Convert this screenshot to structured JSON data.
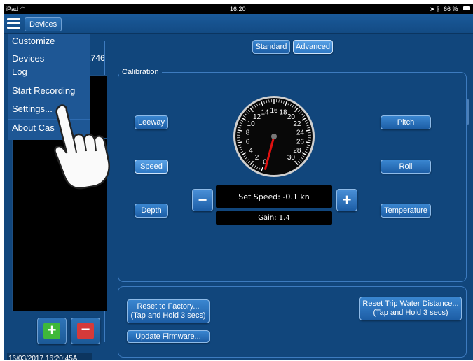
{
  "status_bar": {
    "device": "iPad",
    "time": "16:20",
    "battery": "66 %"
  },
  "nav": {
    "devices_label": "Devices"
  },
  "mode_tabs": [
    {
      "label": "Standard"
    },
    {
      "label": "Advanced"
    }
  ],
  "menu": {
    "items": [
      {
        "label": "Customize"
      },
      {
        "label": "Devices"
      },
      {
        "label": "Log"
      },
      {
        "label": "Start Recording"
      },
      {
        "label": "Settings..."
      },
      {
        "label": "About Cas"
      }
    ]
  },
  "device_list": {
    "partial_id": "1746"
  },
  "calibration": {
    "title": "Calibration",
    "left_buttons": [
      {
        "label": "Leeway"
      },
      {
        "label": "Speed"
      },
      {
        "label": "Depth"
      }
    ],
    "right_buttons": [
      {
        "label": "Pitch"
      },
      {
        "label": "Roll"
      },
      {
        "label": "Temperature"
      }
    ],
    "gauge_labels": [
      "0",
      "2",
      "4",
      "6",
      "8",
      "10",
      "12",
      "14",
      "16",
      "18",
      "20",
      "22",
      "24",
      "26",
      "28",
      "30"
    ],
    "set_speed": "Set Speed: -0.1 kn",
    "gain": "Gain: 1.4",
    "minus_label": "−",
    "plus_label": "+"
  },
  "maintenance": {
    "reset_factory_label": "Reset to Factory...",
    "reset_factory_sub": "(Tap and Hold 3 secs)",
    "reset_trip_label": "Reset Trip Water Distance...",
    "reset_trip_sub": "(Tap and Hold 3 secs)",
    "update_firmware_label": "Update Firmware..."
  },
  "footer": {
    "timestamp": "16/03/2017 16:20:45A"
  },
  "colors": {
    "background": "#11467c",
    "button": "#2e78c4",
    "menu": "#1e5795",
    "needle": "#e01010"
  }
}
